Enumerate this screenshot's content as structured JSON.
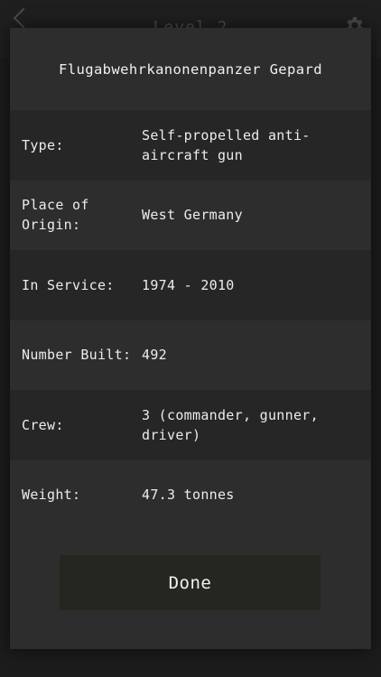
{
  "appbar": {
    "title": "Level 2",
    "back_icon": "chevron-left-icon",
    "settings_icon": "gear-icon"
  },
  "modal": {
    "title": "Flugabwehrkanonenpanzer Gepard",
    "rows": [
      {
        "label": "Type:",
        "value": "Self-propelled anti-aircraft gun"
      },
      {
        "label": "Place of Origin:",
        "value": "West Germany"
      },
      {
        "label": "In Service:",
        "value": "1974 - 2010"
      },
      {
        "label": "Number Built:",
        "value": "492"
      },
      {
        "label": "Crew:",
        "value": "3 (commander, gunner, driver)"
      },
      {
        "label": "Weight:",
        "value": "47.3 tonnes"
      }
    ],
    "done_label": "Done"
  },
  "colors": {
    "background": "#1c1c1c",
    "modal": "#2d2d2d",
    "row_dark": "#262626",
    "button": "#262620",
    "text": "#ececec"
  }
}
